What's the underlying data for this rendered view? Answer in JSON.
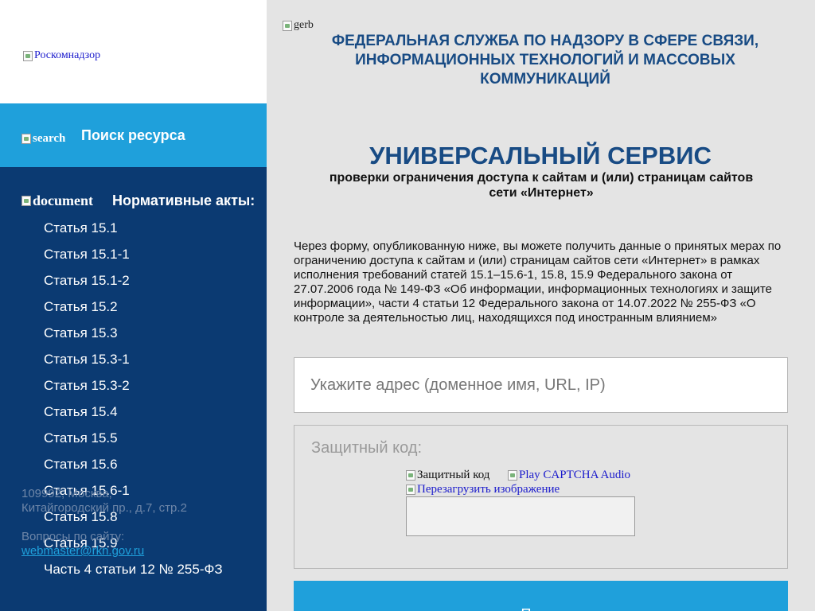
{
  "sidebar": {
    "logo_alt": "Роскомнадзор",
    "search_icon_alt": "search",
    "search_label": "Поиск ресурса",
    "docs_icon_alt": "document",
    "docs_label": "Нормативные акты:",
    "nav_items": [
      "Статья 15.1",
      "Статья 15.1-1",
      "Статья 15.1-2",
      "Статья 15.2",
      "Статья 15.3",
      "Статья 15.3-1",
      "Статья 15.3-2",
      "Статья 15.4",
      "Статья 15.5",
      "Статья 15.6",
      "Статья 15.6-1",
      "Статья 15.8",
      "Статья 15.9",
      "Часть 4 статьи 12 № 255-ФЗ"
    ],
    "footer": {
      "address_line1": "109992, Москва,",
      "address_line2": "Китайгородский пр., д.7, стр.2",
      "questions": "Вопросы по сайту:",
      "email": "webmaster@rkn.gov.ru"
    }
  },
  "header": {
    "gerb_alt": "gerb",
    "agency_name": "ФЕДЕРАЛЬНАЯ СЛУЖБА ПО НАДЗОРУ В СФЕРЕ СВЯЗИ, ИНФОРМАЦИОННЫХ ТЕХНОЛОГИЙ И МАССОВЫХ КОММУНИКАЦИЙ"
  },
  "main": {
    "title": "УНИВЕРСАЛЬНЫЙ СЕРВИС",
    "subtitle": "проверки ограничения доступа к сайтам и (или) страницам сайтов сети «Интернет»",
    "intro": "Через форму, опубликованную ниже, вы можете получить данные о принятых мерах по ограничению доступа к сайтам и (или) страницам сайтов сети «Интернет» в рамках исполнения требований статей 15.1–15.6-1, 15.8, 15.9 Федерального закона от 27.07.2006 года № 149-ФЗ «Об информации, информационных технологиях и защите информации», части 4 статьи 12 Федерального закона от 14.07.2022 № 255-ФЗ «О контроле за деятельностью лиц, находящихся под иностранным влиянием»",
    "address_placeholder": "Укажите адрес (доменное имя, URL, IP)",
    "captcha": {
      "label": "Защитный код:",
      "image_alt": "Защитный код",
      "audio_link": "Play CAPTCHA Audio",
      "reload_link": "Перезагрузить изображение"
    },
    "submit_label": "Поиск"
  }
}
